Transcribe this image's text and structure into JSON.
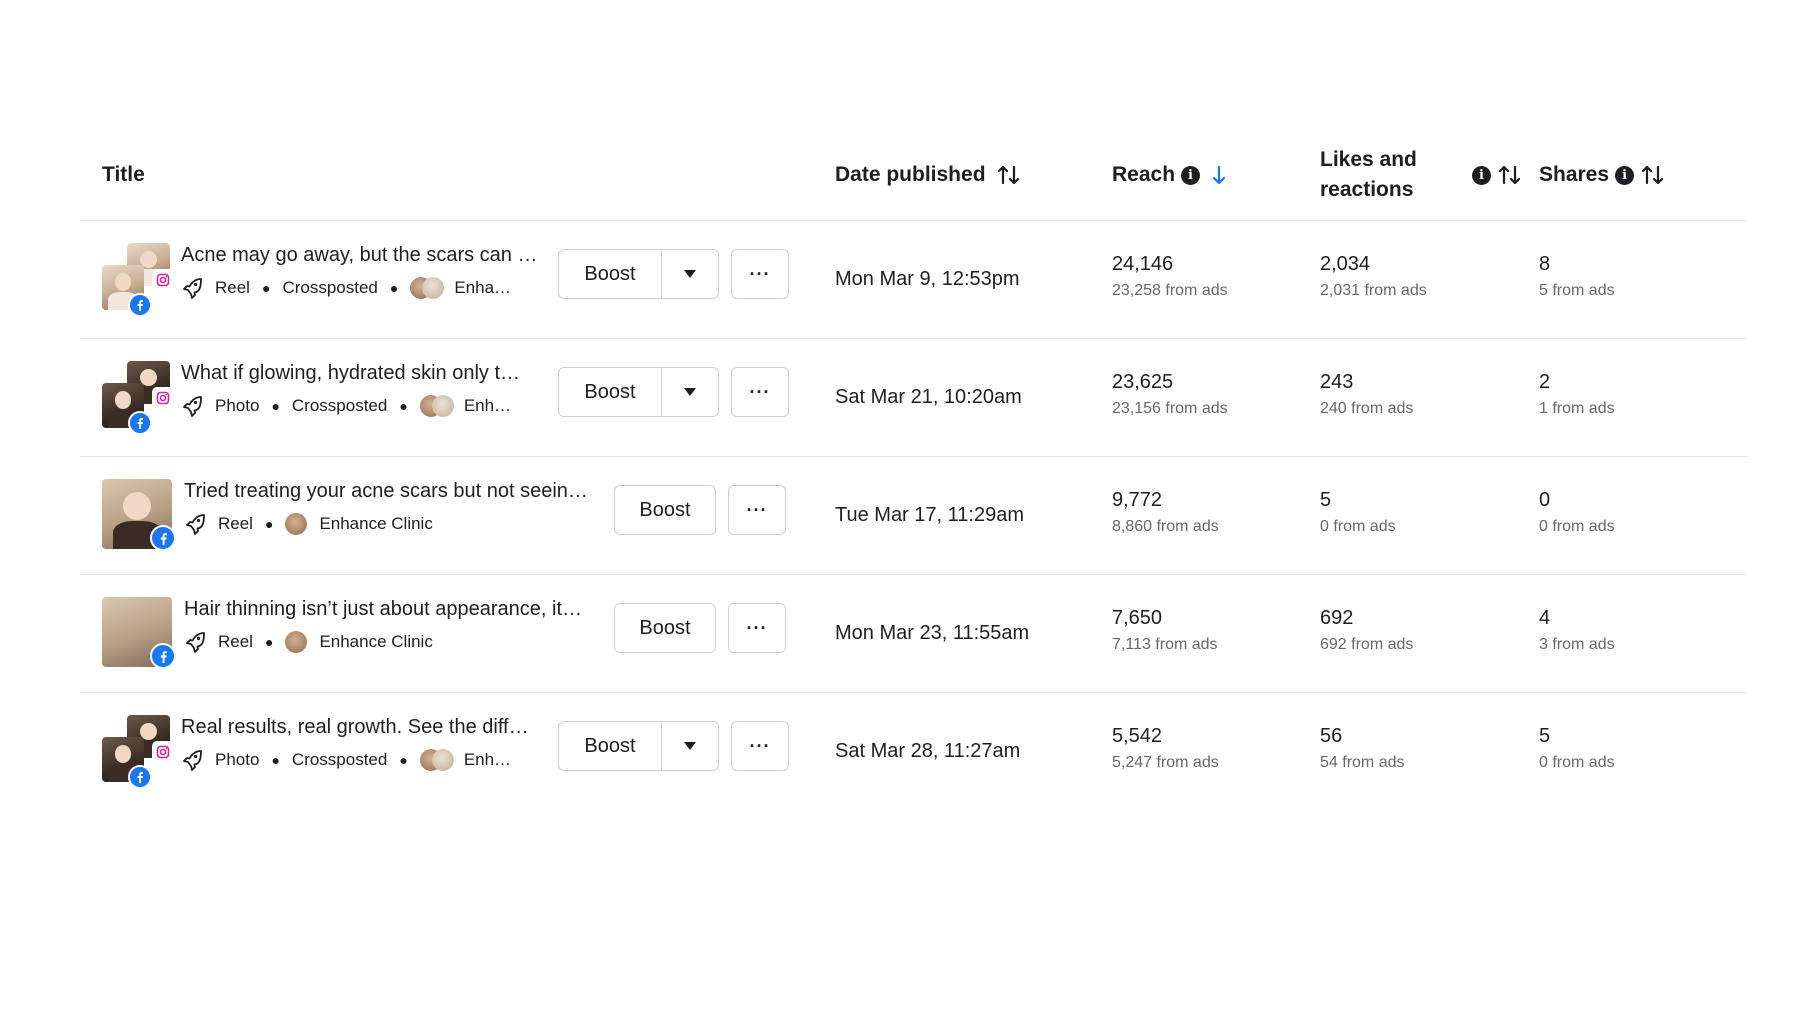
{
  "header": {
    "title": "Title",
    "date_published": "Date published",
    "reach": "Reach",
    "likes_line1": "Likes and",
    "likes_line2": "reactions",
    "shares": "Shares"
  },
  "accent_color": "#1877f2",
  "rows": [
    {
      "title": "Acne may go away, but the scars can …",
      "type": "Reel",
      "crossposted": "Crossposted",
      "account": "Enha…",
      "boost": "Boost",
      "date": "Mon Mar 9, 12:53pm",
      "reach": "24,146",
      "reach_ads": "23,258 from ads",
      "likes": "2,034",
      "likes_ads": "2,031 from ads",
      "shares": "8",
      "shares_ads": "5 from ads"
    },
    {
      "title": "What if glowing, hydrated skin only t…",
      "type": "Photo",
      "crossposted": "Crossposted",
      "account": "Enh…",
      "boost": "Boost",
      "date": "Sat Mar 21, 10:20am",
      "reach": "23,625",
      "reach_ads": "23,156 from ads",
      "likes": "243",
      "likes_ads": "240 from ads",
      "shares": "2",
      "shares_ads": "1 from ads"
    },
    {
      "title": "Tried treating your acne scars but not seein…",
      "type": "Reel",
      "account": "Enhance Clinic",
      "boost": "Boost",
      "date": "Tue Mar 17, 11:29am",
      "reach": "9,772",
      "reach_ads": "8,860 from ads",
      "likes": "5",
      "likes_ads": "0 from ads",
      "shares": "0",
      "shares_ads": "0 from ads"
    },
    {
      "title": "Hair thinning isn’t just about appearance, it…",
      "type": "Reel",
      "account": "Enhance Clinic",
      "boost": "Boost",
      "date": "Mon Mar 23, 11:55am",
      "reach": "7,650",
      "reach_ads": "7,113 from ads",
      "likes": "692",
      "likes_ads": "692 from ads",
      "shares": "4",
      "shares_ads": "3 from ads"
    },
    {
      "title": "Real results, real growth. See the diff…",
      "type": "Photo",
      "crossposted": "Crossposted",
      "account": "Enh…",
      "boost": "Boost",
      "date": "Sat Mar 28, 11:27am",
      "reach": "5,542",
      "reach_ads": "5,247 from ads",
      "likes": "56",
      "likes_ads": "54 from ads",
      "shares": "5",
      "shares_ads": "0 from ads"
    }
  ]
}
